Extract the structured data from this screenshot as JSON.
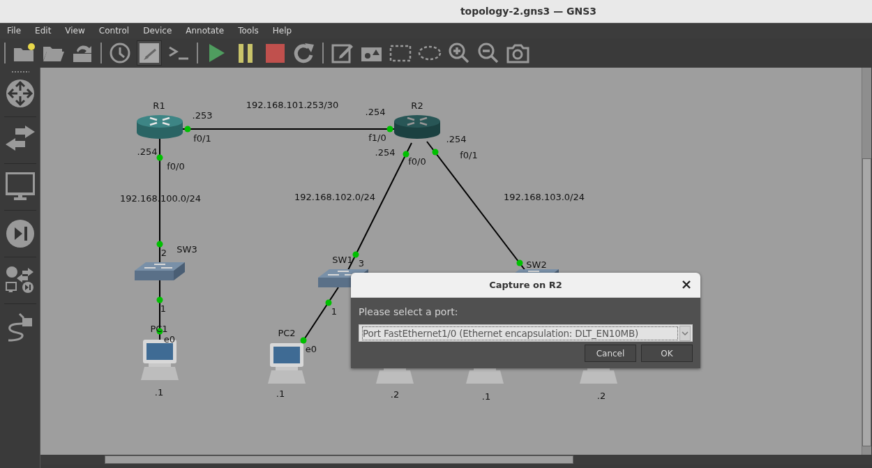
{
  "window": {
    "title": "topology-2.gns3 — GNS3"
  },
  "menu": [
    "File",
    "Edit",
    "View",
    "Control",
    "Device",
    "Annotate",
    "Tools",
    "Help"
  ],
  "toolbar": [
    {
      "kind": "new",
      "on": false
    },
    {
      "kind": "open",
      "on": false
    },
    {
      "kind": "snapshot",
      "on": false
    },
    {
      "kind": "sep"
    },
    {
      "kind": "history",
      "on": false
    },
    {
      "kind": "labels",
      "on": true
    },
    {
      "kind": "console",
      "on": false
    },
    {
      "kind": "sep"
    },
    {
      "kind": "start",
      "on": false
    },
    {
      "kind": "suspend",
      "on": false
    },
    {
      "kind": "stop",
      "on": false
    },
    {
      "kind": "reload",
      "on": false
    },
    {
      "kind": "sep"
    },
    {
      "kind": "note",
      "on": false
    },
    {
      "kind": "image",
      "on": false
    },
    {
      "kind": "rectangle",
      "on": false
    },
    {
      "kind": "ellipse",
      "on": false
    },
    {
      "kind": "zoom-in",
      "on": false
    },
    {
      "kind": "zoom-out",
      "on": false
    },
    {
      "kind": "screenshot",
      "on": false
    }
  ],
  "dock": [
    {
      "kind": "router"
    },
    {
      "kind": "switch"
    },
    {
      "kind": "end-device"
    },
    {
      "kind": "security"
    },
    {
      "kind": "all"
    },
    {
      "kind": "link"
    }
  ],
  "topology": {
    "nodes": [
      {
        "kind": "router",
        "name": "R1",
        "selected": false
      },
      {
        "kind": "router",
        "name": "R2",
        "selected": true
      },
      {
        "kind": "switch",
        "name": "SW3",
        "selected": false
      },
      {
        "kind": "switch",
        "name": "SW1",
        "selected": false
      },
      {
        "kind": "switch",
        "name": "SW2",
        "selected": false
      },
      {
        "kind": "pc",
        "name": "PC1",
        "address": ".1",
        "selected": false
      },
      {
        "kind": "pc",
        "name": "PC2",
        "address": ".1",
        "selected": false
      },
      {
        "kind": "pc",
        "address": ".2",
        "selected": false
      },
      {
        "kind": "pc",
        "address": ".1",
        "selected": false
      },
      {
        "kind": "pc",
        "address": ".2",
        "selected": false
      }
    ],
    "links": [
      {
        "subnet": "192.168.101.253/30",
        "ends": [
          {
            "up": true,
            "port": "f0/1",
            "address": ".253"
          },
          {
            "up": true,
            "port": "f1/0",
            "address": ".254"
          }
        ]
      },
      {
        "subnet": "192.168.100.0/24",
        "ends": [
          {
            "up": true,
            "port": "f0/0",
            "address": ".254"
          },
          {
            "up": true,
            "port": "2"
          }
        ]
      },
      {
        "subnet": "192.168.102.0/24",
        "ends": [
          {
            "up": true,
            "port": "f0/0",
            "address": ".254"
          },
          {
            "up": true,
            "port": "3"
          }
        ]
      },
      {
        "subnet": "192.168.103.0/24",
        "ends": [
          {
            "up": true,
            "port": "f0/1",
            "address": ".254"
          },
          {
            "up": true
          }
        ]
      },
      {
        "ends": [
          {
            "up": true,
            "port": "1"
          },
          {
            "up": true,
            "port": "e0"
          }
        ]
      },
      {
        "ends": [
          {
            "up": true,
            "port": "1"
          },
          {
            "up": true,
            "port": "e0"
          }
        ]
      }
    ]
  },
  "dialog": {
    "title": "Capture on R2",
    "prompt": "Please select a port:",
    "port": "Port FastEthernet1/0 (Ethernet encapsulation: DLT_EN10MB)",
    "buttons": [
      "Cancel",
      "OK"
    ]
  }
}
